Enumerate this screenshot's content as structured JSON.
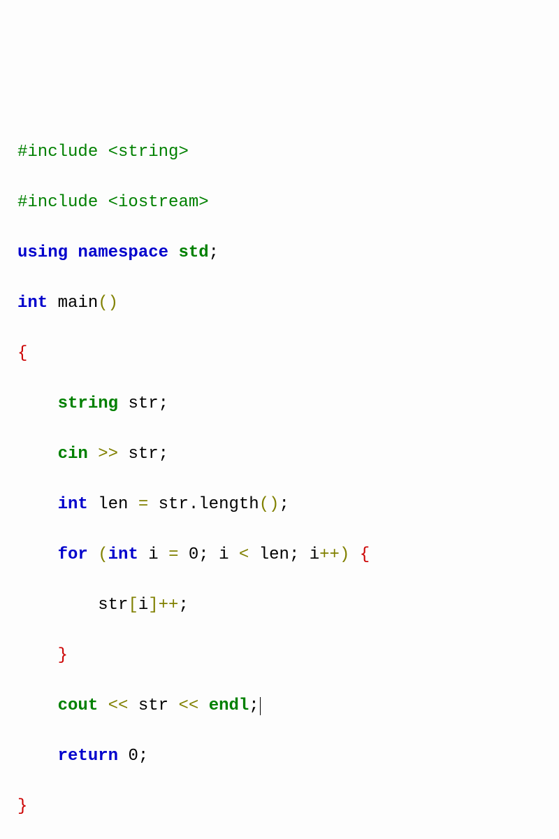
{
  "code": {
    "line1": {
      "t1": "#include <string>"
    },
    "line2": {
      "t1": "#include <iostream>"
    },
    "line3": {
      "kw1": "using",
      "sp1": " ",
      "kw2": "namespace",
      "sp2": " ",
      "id": "std",
      "semi": ";"
    },
    "line4": {
      "kw1": "int",
      "sp1": " ",
      "id": "main",
      "par": "()"
    },
    "line5": {
      "br": "{"
    },
    "line6": {
      "indent": "    ",
      "kw1": "string",
      "sp1": " ",
      "id": "str",
      "semi": ";"
    },
    "line7": {
      "indent": "    ",
      "kw1": "cin",
      "sp1": " ",
      "op": ">>",
      "sp2": " ",
      "id": "str",
      "semi": ";"
    },
    "line8": {
      "indent": "    ",
      "kw1": "int",
      "sp1": " ",
      "id1": "len ",
      "op": "=",
      "id2": " str.length",
      "par": "()",
      "semi": ";"
    },
    "line9": {
      "indent": "    ",
      "kw1": "for",
      "sp1": " ",
      "lp": "(",
      "kw2": "int",
      "sp2": " ",
      "id1": "i ",
      "op1": "=",
      "sp3": " ",
      "num": "0",
      "semi1": ";",
      "id2": " i ",
      "op2": "<",
      "id3": " len",
      "semi2": ";",
      "id4": " i",
      "op3": "++",
      "rp": ")",
      "sp4": " ",
      "br": "{"
    },
    "line10": {
      "indent": "        ",
      "id1": "str",
      "lb": "[",
      "id2": "i",
      "rb": "]",
      "op": "++",
      "semi": ";"
    },
    "line11": {
      "indent": "    ",
      "br": "}"
    },
    "line12": {
      "indent": "    ",
      "kw1": "cout",
      "sp1": " ",
      "op1": "<<",
      "sp2": " ",
      "id": "str",
      "sp3": " ",
      "op2": "<<",
      "sp4": " ",
      "kw2": "endl",
      "semi": ";"
    },
    "line13": {
      "indent": "    ",
      "kw1": "return",
      "sp1": " ",
      "num": "0",
      "semi": ";"
    },
    "line14": {
      "br": "}"
    }
  }
}
